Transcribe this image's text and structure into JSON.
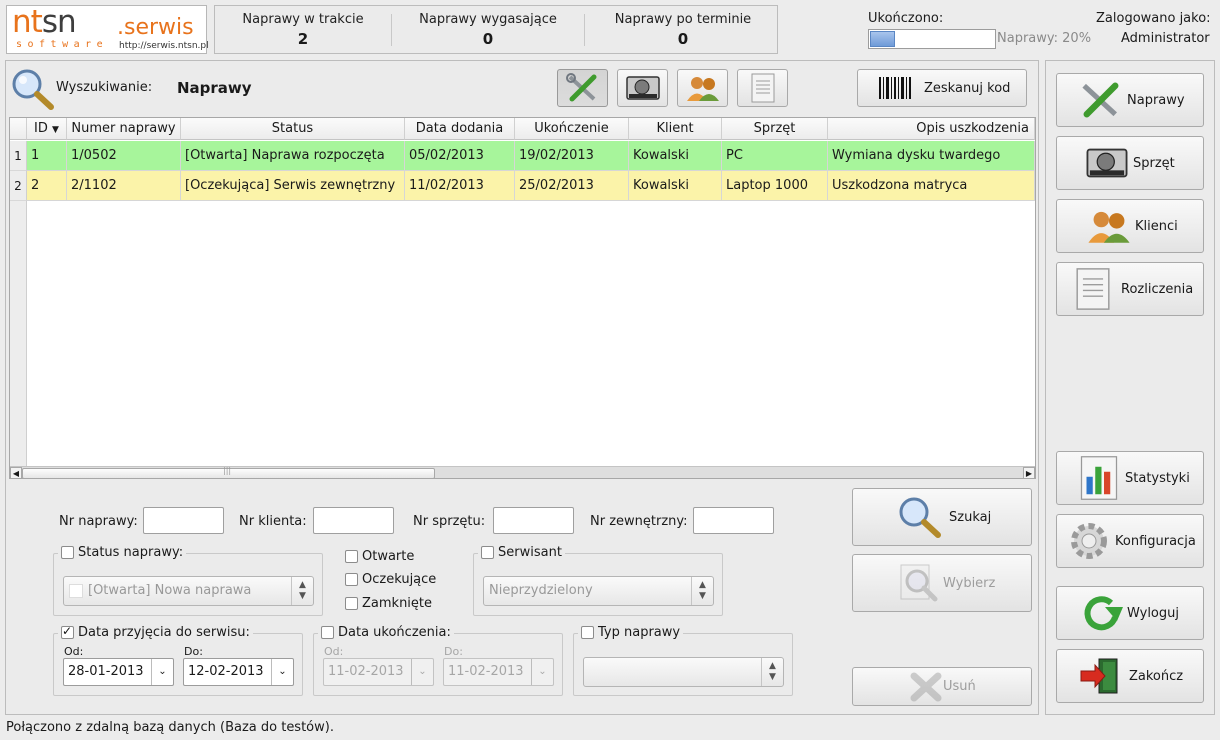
{
  "logo": {
    "text_nt": "nt",
    "text_sn": "sn",
    "text_serwis": ".serwis",
    "text_software": "software",
    "url": "http://serwis.ntsn.pl"
  },
  "stats": [
    {
      "label": "Naprawy w trakcie",
      "value": "2"
    },
    {
      "label": "Naprawy wygasające",
      "value": "0"
    },
    {
      "label": "Naprawy po terminie",
      "value": "0"
    }
  ],
  "progress": {
    "label": "Ukończono:",
    "text": "Naprawy: 20%",
    "fraction": 0.2
  },
  "user": {
    "label": "Zalogowano jako:",
    "name": "Administrator"
  },
  "search": {
    "label": "Wyszukiwanie:",
    "mode": "Naprawy"
  },
  "toolbar": {
    "scan_label": "Zeskanuj kod"
  },
  "table": {
    "columns": [
      "ID",
      "Numer naprawy",
      "Status",
      "Data dodania",
      "Ukończenie",
      "Klient",
      "Sprzęt",
      "Opis uszkodzenia"
    ],
    "rows": [
      {
        "num": "1",
        "cells": [
          "1",
          "1/0502",
          "[Otwarta] Naprawa rozpoczęta",
          "05/02/2013",
          "19/02/2013",
          "Kowalski",
          "PC",
          "Wymiana dysku twardego"
        ]
      },
      {
        "num": "2",
        "cells": [
          "2",
          "2/1102",
          "[Oczekująca] Serwis zewnętrzny",
          "11/02/2013",
          "25/02/2013",
          "Kowalski",
          "Laptop 1000",
          "Uszkodzona matryca"
        ]
      }
    ],
    "hscroll_mark": "|||"
  },
  "form": {
    "nr_naprawy": "Nr naprawy:",
    "nr_klienta": "Nr klienta:",
    "nr_sprzetu": "Nr sprzętu:",
    "nr_zewnetrzny": "Nr zewnętrzny:",
    "status_label": "Status naprawy:",
    "status_value": "[Otwarta] Nowa naprawa",
    "otwarte": "Otwarte",
    "oczekujace": "Oczekujące",
    "zamkniete": "Zamknięte",
    "serwisant_label": "Serwisant",
    "serwisant_value": "Nieprzydzielony",
    "przyjecie_label": "Data przyjęcia do serwisu:",
    "od": "Od:",
    "do": "Do:",
    "przyjecie_od": "28-01-2013",
    "przyjecie_do": "12-02-2013",
    "ukonczenie_label": "Data ukończenia:",
    "ukonczenie_od": "11-02-2013",
    "ukonczenie_do": "11-02-2013",
    "typ_label": "Typ naprawy",
    "typ_value": ""
  },
  "actions": {
    "szukaj": "Szukaj",
    "wybierz": "Wybierz",
    "usun": "Usuń"
  },
  "sidebar": {
    "naprawy": "Naprawy",
    "sprzet": "Sprzęt",
    "klienci": "Klienci",
    "rozliczenia": "Rozliczenia",
    "statystyki": "Statystyki",
    "konfiguracja": "Konfiguracja",
    "wyloguj": "Wyloguj",
    "zakoncz": "Zakończ"
  },
  "status_bar": "Połączono z zdalną bazą danych (Baza do testów).",
  "colors": {
    "open_row": "#a7f59b",
    "waiting_row": "#fbf3a9",
    "accent": "#e8731c"
  }
}
